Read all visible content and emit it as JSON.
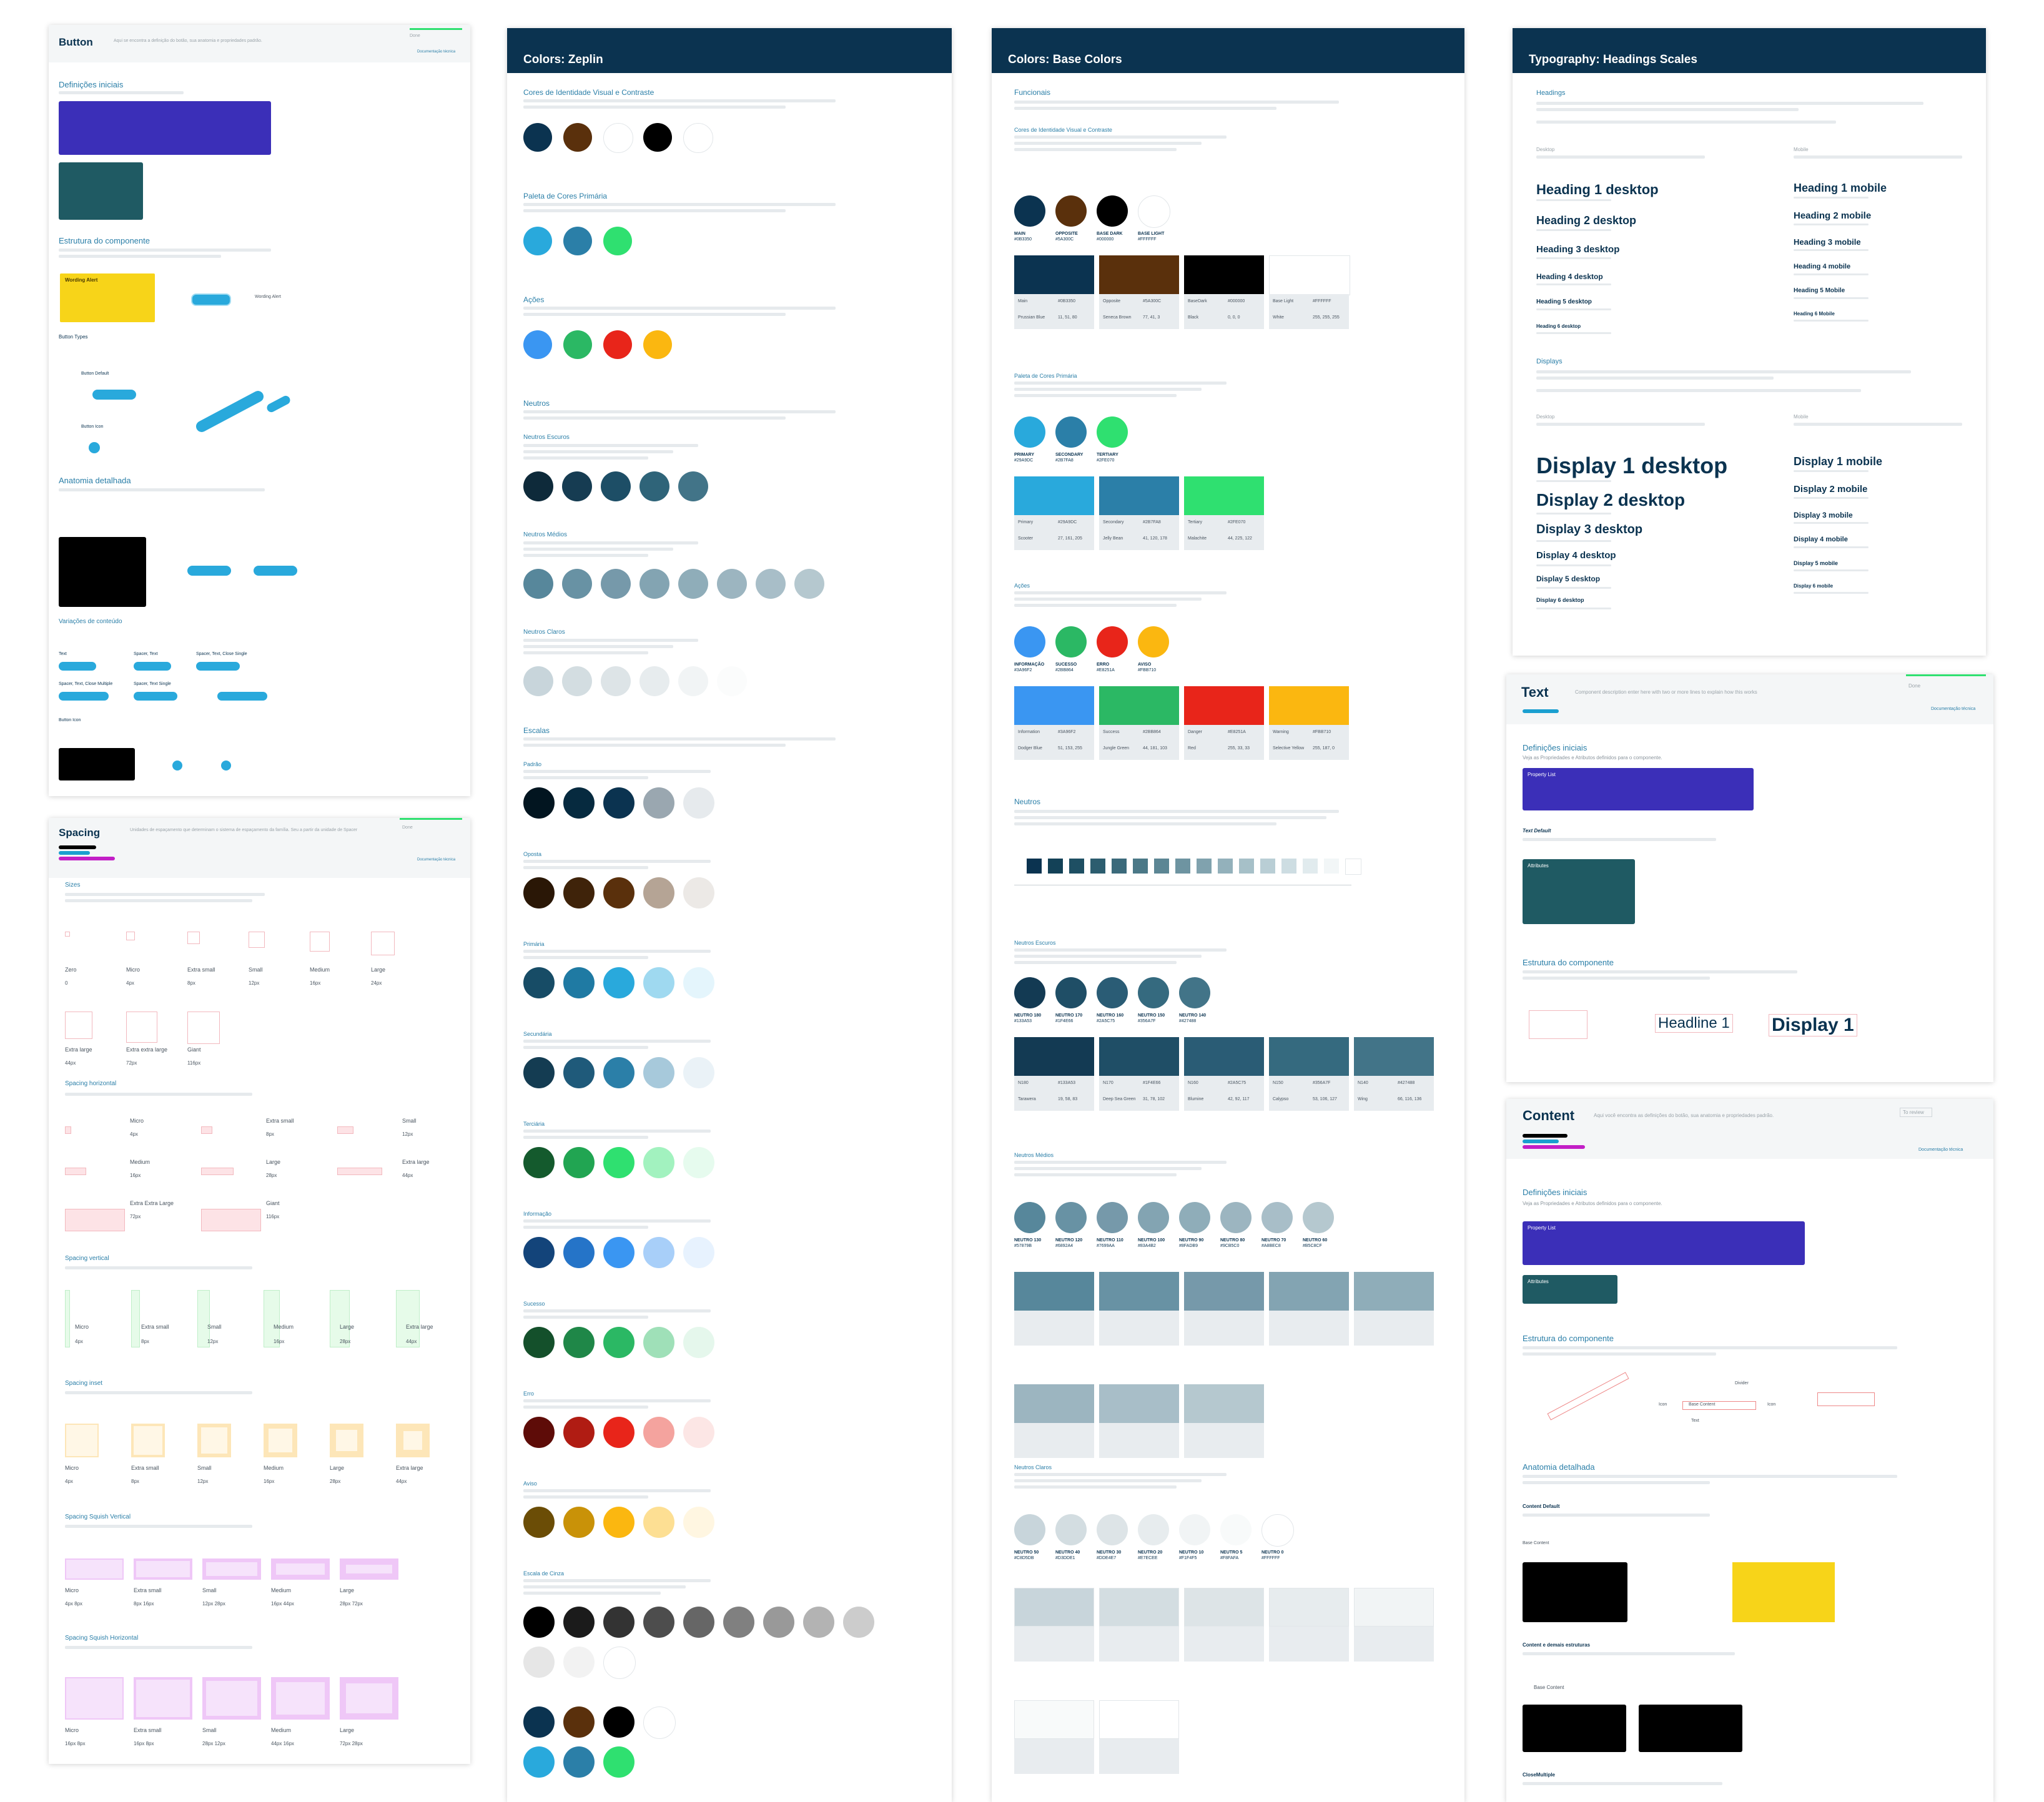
{
  "button_page": {
    "title": "Button",
    "subtitle": "Aqui se encontra a definição do botão, sua anatomia e propriedades padrão.",
    "status": "Done",
    "doc_link": "Documentação técnica",
    "sections": {
      "definicoes": "Definições iniciais",
      "estrutura": "Estrutura do componente",
      "anatomia": "Anatomia detalhada",
      "variacoes": "Variações de conteúdo"
    },
    "labels": {
      "button_types": "Button Types",
      "button_default": "Button Default",
      "button_icon": "Button Icon",
      "wording_alert": "Wording Alert",
      "content": "Content",
      "button": "Button",
      "text": "Text",
      "spacer_text": "Spacer, Text",
      "spacer_text_close": "Spacer, Text, Close Single",
      "spacer_text_close_multiple": "Spacer, Text, Close Multiple",
      "spacer_text_single": "Spacer, Text Single",
      "icon": "Icon"
    }
  },
  "spacing_page": {
    "title": "Spacing",
    "subtitle": "Unidades de espaçamento que determinam o sistema de espaçamento da família. Seu a partir da unidade de Spacer",
    "status": "Done",
    "doc_link": "Documentação técnica",
    "sections": {
      "sizes": "Sizes",
      "horizontal": "Spacing horizontal",
      "vertical": "Spacing vertical",
      "inset": "Spacing inset",
      "squish_vertical": "Spacing Squish Vertical",
      "squish_horizontal": "Spacing Squish Horizontal"
    },
    "sizes": [
      {
        "name": "Zero",
        "value": "0"
      },
      {
        "name": "Micro",
        "value": "4px"
      },
      {
        "name": "Extra small",
        "value": "8px"
      },
      {
        "name": "Small",
        "value": "12px"
      },
      {
        "name": "Medium",
        "value": "16px"
      },
      {
        "name": "Large",
        "value": "24px"
      },
      {
        "name": "Extra large",
        "value": "44px"
      },
      {
        "name": "Extra extra large",
        "value": "72px"
      },
      {
        "name": "Giant",
        "value": "116px"
      }
    ],
    "horizontal": [
      {
        "name": "Micro",
        "value": "4px"
      },
      {
        "name": "Extra small",
        "value": "8px"
      },
      {
        "name": "Small",
        "value": "12px"
      },
      {
        "name": "Medium",
        "value": "16px"
      },
      {
        "name": "Large",
        "value": "28px"
      },
      {
        "name": "Extra large",
        "value": "44px"
      },
      {
        "name": "Extra Extra Large",
        "value": "72px"
      },
      {
        "name": "Giant",
        "value": "116px"
      }
    ],
    "vertical": [
      {
        "name": "Micro",
        "value": "4px"
      },
      {
        "name": "Extra small",
        "value": "8px"
      },
      {
        "name": "Small",
        "value": "12px"
      },
      {
        "name": "Medium",
        "value": "16px"
      },
      {
        "name": "Large",
        "value": "28px"
      },
      {
        "name": "Extra large",
        "value": "44px"
      }
    ],
    "inset": [
      {
        "name": "Micro",
        "value": "4px"
      },
      {
        "name": "Extra small",
        "value": "8px"
      },
      {
        "name": "Small",
        "value": "12px"
      },
      {
        "name": "Medium",
        "value": "16px"
      },
      {
        "name": "Large",
        "value": "28px"
      },
      {
        "name": "Extra large",
        "value": "44px"
      }
    ],
    "squish_vertical": [
      {
        "name": "Micro",
        "value": "4px 8px"
      },
      {
        "name": "Extra small",
        "value": "8px 16px"
      },
      {
        "name": "Small",
        "value": "12px 28px"
      },
      {
        "name": "Medium",
        "value": "16px 44px"
      },
      {
        "name": "Large",
        "value": "28px 72px"
      }
    ],
    "squish_horizontal": [
      {
        "name": "Micro",
        "value": "16px 8px"
      },
      {
        "name": "Extra small",
        "value": "16px 8px"
      },
      {
        "name": "Small",
        "value": "28px 12px"
      },
      {
        "name": "Medium",
        "value": "44px 16px"
      },
      {
        "name": "Large",
        "value": "72px 28px"
      }
    ]
  },
  "zeplin_page": {
    "title": "Colors: Zeplin",
    "sections": [
      {
        "title": "Cores de Identidade Visual e Contraste",
        "colors": [
          "#0b3350",
          "#5a300c",
          "#ffffff",
          "#000000",
          "#ffffff"
        ]
      },
      {
        "title": "Paleta de Cores Primária",
        "colors": [
          "#29a9dc",
          "#2b7fa8",
          "#2fe070"
        ]
      },
      {
        "title": "Ações",
        "colors": [
          "#3a96f2",
          "#2bb864",
          "#e8251a",
          "#fbb710"
        ]
      },
      {
        "title": "Neutros",
        "colors": []
      }
    ],
    "neutros_escuros": {
      "title": "Neutros Escuros",
      "colors": [
        "#0e2a3a",
        "#163c52",
        "#1d4e66",
        "#2f6479",
        "#427488"
      ]
    },
    "neutros_medios": {
      "title": "Neutros Médios",
      "colors": [
        "#57879b",
        "#6892a4",
        "#7699aa",
        "#83a4b2",
        "#8fadb9",
        "#9cb5c0",
        "#a8bec8",
        "#b5c8cf"
      ]
    },
    "neutros_claros": {
      "title": "Neutros Claros",
      "colors": [
        "#c8d5db",
        "#d3dde1",
        "#dde4e7",
        "#e7ecee",
        "#f1f4f5",
        "#fbfcfc"
      ]
    },
    "escalas_title": "Escalas",
    "escalas": [
      {
        "title": "Padrão",
        "colors": [
          "#021520",
          "#062a3f",
          "#0b3350",
          "#9aa7b0",
          "#e6eaed"
        ]
      },
      {
        "title": "Oposta",
        "colors": [
          "#2a1706",
          "#3f230a",
          "#5a300c",
          "#b5a495",
          "#ece9e6"
        ]
      },
      {
        "title": "Primária",
        "colors": [
          "#174c66",
          "#1f7aa3",
          "#29a9dc",
          "#9fd9f0",
          "#e4f5fc"
        ]
      },
      {
        "title": "Secundária",
        "colors": [
          "#143c52",
          "#1f5a7a",
          "#2b7fa8",
          "#a7c9db",
          "#eaf2f7"
        ]
      },
      {
        "title": "Terciária",
        "colors": [
          "#145a2d",
          "#21a552",
          "#2fe070",
          "#a2f2bf",
          "#e6fbee"
        ]
      },
      {
        "title": "Informação",
        "colors": [
          "#13447a",
          "#2574c8",
          "#3a96f2",
          "#a8cff9",
          "#e7f2fe"
        ]
      },
      {
        "title": "Sucesso",
        "colors": [
          "#14502b",
          "#1f8748",
          "#2bb864",
          "#9fe0b8",
          "#e5f7ec"
        ]
      },
      {
        "title": "Erro",
        "colors": [
          "#5e0c08",
          "#b01c13",
          "#e8251a",
          "#f4a39e",
          "#fce6e5"
        ]
      },
      {
        "title": "Aviso",
        "colors": [
          "#6b4d06",
          "#c99208",
          "#fbb710",
          "#fddf93",
          "#fff6e1"
        ]
      }
    ],
    "cinza": {
      "title": "Escala de Cinza",
      "colors": [
        "#000000",
        "#1b1b1b",
        "#333333",
        "#4d4d4d",
        "#666666",
        "#808080",
        "#999999",
        "#b3b3b3",
        "#cccccc",
        "#e6e6e6",
        "#f2f2f2",
        "#ffffff"
      ]
    },
    "bottom": {
      "colors": [
        "#0b3350",
        "#5a300c",
        "#000000",
        "#ffffff",
        "#29a9dc",
        "#2b7fa8",
        "#2fe070"
      ]
    },
    "body_text": "Lorem ipsum dolor sit amet, consetetur sadipscing elitr, sed diam nonumy eirmod tempor invidunt ut labore et dolore magna aliquyam erat, sed diam voluptua. At vero eos et accusam et justo duo dolores et ea rebum. Stet clita kasd gubergren, no sea."
  },
  "base_page": {
    "title": "Colors: Base Colors",
    "funcionais": "Funcionais",
    "identity": {
      "title": "Cores de Identidade Visual e Contraste",
      "items": [
        {
          "name": "MAIN",
          "hex": "#0B3350",
          "color": "#0b3350"
        },
        {
          "name": "OPPOSITE",
          "hex": "#5A300C",
          "color": "#5a300c"
        },
        {
          "name": "BASE DARK",
          "hex": "#000000",
          "color": "#000000"
        },
        {
          "name": "BASE LIGHT",
          "hex": "#FFFFFF",
          "color": "#ffffff"
        }
      ],
      "cards": [
        {
          "name": "Main",
          "value": "#0B3350",
          "alias": "Prussian Blue",
          "rgb": "11, 51, 80"
        },
        {
          "name": "Opposite",
          "value": "#5A300C",
          "alias": "Seneca Brown",
          "rgb": "77, 41, 3"
        },
        {
          "name": "BaseDark",
          "value": "#000000",
          "alias": "Black",
          "rgb": "0, 0, 0"
        },
        {
          "name": "Base Light",
          "value": "#FFFFFF",
          "alias": "White",
          "rgb": "255, 255, 255"
        }
      ]
    },
    "primaria": {
      "title": "Paleta de Cores Primária",
      "items": [
        {
          "name": "PRIMARY",
          "hex": "#29A9DC",
          "color": "#29a9dc"
        },
        {
          "name": "SECONDARY",
          "hex": "#2B7FA8",
          "color": "#2b7fa8"
        },
        {
          "name": "TERTIARY",
          "hex": "#2FE070",
          "color": "#2fe070"
        }
      ],
      "cards": [
        {
          "name": "Primary",
          "value": "#29A9DC",
          "alias": "Scooter",
          "rgb": "27, 161, 205"
        },
        {
          "name": "Secondary",
          "value": "#2B7FA8",
          "alias": "Jelly Bean",
          "rgb": "41, 120, 178"
        },
        {
          "name": "Tertiary",
          "value": "#2FE070",
          "alias": "Malachite",
          "rgb": "44, 225, 122"
        }
      ]
    },
    "acoes": {
      "title": "Ações",
      "items": [
        {
          "name": "INFORMAÇÃO",
          "hex": "#3A96F2",
          "color": "#3a96f2"
        },
        {
          "name": "SUCESSO",
          "hex": "#2BB864",
          "color": "#2bb864"
        },
        {
          "name": "ERRO",
          "hex": "#E8251A",
          "color": "#e8251a"
        },
        {
          "name": "AVISO",
          "hex": "#FBB710",
          "color": "#fbb710"
        }
      ],
      "cards": [
        {
          "name": "Information",
          "value": "#3A96F2",
          "alias": "Dodger Blue",
          "rgb": "51, 153, 255"
        },
        {
          "name": "Success",
          "value": "#2BB864",
          "alias": "Jungle Green",
          "rgb": "44, 181, 103"
        },
        {
          "name": "Danger",
          "value": "#E8251A",
          "alias": "Red",
          "rgb": "255, 33, 33"
        },
        {
          "name": "Warning",
          "value": "#FBB710",
          "alias": "Selective Yellow",
          "rgb": "255, 187, 0"
        }
      ]
    },
    "neutros": "Neutros",
    "ramp": [
      "#0b3350",
      "#134157",
      "#1e4f63",
      "#2c5d6f",
      "#3b6a7b",
      "#4b7887",
      "#5c8694",
      "#6e94a1",
      "#80a2ae",
      "#93b1bb",
      "#a6c0c8",
      "#b9ced5",
      "#cddde2",
      "#e1ebee",
      "#f2f6f7",
      "#ffffff"
    ],
    "neutros_escuros": {
      "title": "Neutros Escuros",
      "items": [
        {
          "name": "NEUTRO 180",
          "hex": "#133A53",
          "color": "#133a53"
        },
        {
          "name": "NEUTRO 170",
          "hex": "#1F4E66",
          "color": "#1f4e66"
        },
        {
          "name": "NEUTRO 160",
          "hex": "#2A5C75",
          "color": "#2a5c75"
        },
        {
          "name": "NEUTRO 150",
          "hex": "#356A7F",
          "color": "#356a7f"
        },
        {
          "name": "NEUTRO 140",
          "hex": "#427488",
          "color": "#427488"
        }
      ],
      "cards": [
        {
          "name": "N180",
          "value": "#133A53",
          "alias": "Tarawera",
          "rgb": "19, 58, 83"
        },
        {
          "name": "N170",
          "value": "#1F4E66",
          "alias": "Deep Sea Green",
          "rgb": "31, 78, 102"
        },
        {
          "name": "N160",
          "value": "#2A5C75",
          "alias": "Blumine",
          "rgb": "42, 92, 117"
        },
        {
          "name": "N150",
          "value": "#356A7F",
          "alias": "Calypso",
          "rgb": "53, 106, 127"
        },
        {
          "name": "N140",
          "value": "#427488",
          "alias": "Wing",
          "rgb": "66, 116, 136"
        }
      ]
    },
    "neutros_medios": {
      "title": "Neutros Médios",
      "items": [
        {
          "name": "NEUTRO 130",
          "hex": "#57879B",
          "color": "#57879b"
        },
        {
          "name": "NEUTRO 120",
          "hex": "#6892A4",
          "color": "#6892a4"
        },
        {
          "name": "NEUTRO 110",
          "hex": "#7699AA",
          "color": "#7699aa"
        },
        {
          "name": "NEUTRO 100",
          "hex": "#83A4B2",
          "color": "#83a4b2"
        },
        {
          "name": "NEUTRO 90",
          "hex": "#8FADB9",
          "color": "#8fadb9"
        },
        {
          "name": "NEUTRO 80",
          "hex": "#9CB5C0",
          "color": "#9cb5c0"
        },
        {
          "name": "NEUTRO 70",
          "hex": "#A8BEC8",
          "color": "#a8bec8"
        },
        {
          "name": "NEUTRO 60",
          "hex": "#B5C8CF",
          "color": "#b5c8cf"
        }
      ]
    },
    "neutros_claros": {
      "title": "Neutros Claros",
      "items": [
        {
          "name": "NEUTRO 50",
          "hex": "#C8D5DB",
          "color": "#c8d5db"
        },
        {
          "name": "NEUTRO 40",
          "hex": "#D3DDE1",
          "color": "#d3dde1"
        },
        {
          "name": "NEUTRO 30",
          "hex": "#DDE4E7",
          "color": "#dde4e7"
        },
        {
          "name": "NEUTRO 20",
          "hex": "#E7ECEE",
          "color": "#e7ecee"
        },
        {
          "name": "NEUTRO 10",
          "hex": "#F1F4F5",
          "color": "#f1f4f5"
        },
        {
          "name": "NEUTRO 5",
          "hex": "#F8FAFA",
          "color": "#f8fafa"
        },
        {
          "name": "NEUTRO 0",
          "hex": "#FFFFFF",
          "color": "#ffffff"
        }
      ]
    }
  },
  "typo_page": {
    "title": "Typography: Headings Scales",
    "headings": "Headings",
    "desktop": "Desktop",
    "mobile": "Mobile",
    "displays": "Displays",
    "desktop_heads": [
      {
        "label": "Heading 1 desktop",
        "size": 22
      },
      {
        "label": "Heading 2 desktop",
        "size": 18
      },
      {
        "label": "Heading 3 desktop",
        "size": 15
      },
      {
        "label": "Heading 4 desktop",
        "size": 12
      },
      {
        "label": "Heading 5 desktop",
        "size": 10
      },
      {
        "label": "Heading 6 desktop",
        "size": 8
      }
    ],
    "mobile_heads": [
      {
        "label": "Heading 1 mobile",
        "size": 18
      },
      {
        "label": "Heading 2 mobile",
        "size": 15
      },
      {
        "label": "Heading 3 mobile",
        "size": 13
      },
      {
        "label": "Heading 4 mobile",
        "size": 11
      },
      {
        "label": "Heading 5 Mobile",
        "size": 10
      },
      {
        "label": "Heading 6 Mobile",
        "size": 8
      }
    ],
    "desktop_displays": [
      {
        "label": "Display 1 desktop",
        "size": 36
      },
      {
        "label": "Display 2 desktop",
        "size": 28
      },
      {
        "label": "Display 3 desktop",
        "size": 20
      },
      {
        "label": "Display 4 desktop",
        "size": 15
      },
      {
        "label": "Display 5 desktop",
        "size": 12
      },
      {
        "label": "Display 6 desktop",
        "size": 9
      }
    ],
    "mobile_displays": [
      {
        "label": "Display 1 mobile",
        "size": 18
      },
      {
        "label": "Display 2 mobile",
        "size": 15
      },
      {
        "label": "Display 3 mobile",
        "size": 12
      },
      {
        "label": "Display 4 mobile",
        "size": 11
      },
      {
        "label": "Display 5 mobile",
        "size": 9
      },
      {
        "label": "Display 6 mobile",
        "size": 8
      }
    ]
  },
  "text_page": {
    "title": "Text",
    "subtitle": "Component description enter here with two or more lines to explain how this works",
    "status": "Done",
    "doc_link": "Documentação técnica",
    "definicoes": "Definições iniciais",
    "definicoes_sub": "Veja as Propriedades e Atributos definidos para o componente.",
    "property_list": "Property List",
    "text_default": "Text Default",
    "attributes": "Attributes",
    "estrutura": "Estrutura do componente",
    "examples": {
      "headline": "Headline 1",
      "display": "Display 1"
    }
  },
  "content_page": {
    "title": "Content",
    "subtitle": "Aqui você encontra as definições do botão, sua anatomia e propriedades padrão.",
    "status": "To review",
    "doc_link": "Documentação técnica",
    "definicoes": "Definições iniciais",
    "definicoes_sub": "Veja as Propriedades e Atributos definidos para o componente.",
    "property_list": "Property List",
    "attributes": "Attributes",
    "estrutura": "Estrutura do componente",
    "anatomia": "Anatomia detalhada",
    "content_default": "Content Default",
    "base_content": "Base Content",
    "content_demais": "Content e demais estruturas",
    "close_multiple": "CloseMultiple",
    "labels": {
      "icon": "Icon",
      "divider": "Divider",
      "text": "Text",
      "content": "Base Content"
    }
  }
}
